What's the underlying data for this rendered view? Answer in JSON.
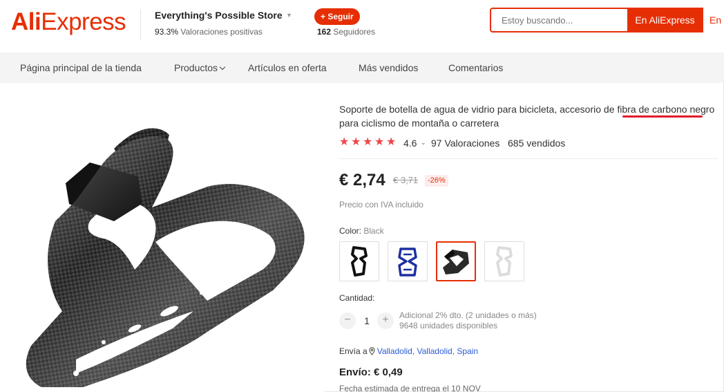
{
  "header": {
    "logo_text_part1": "Ali",
    "logo_text_part2": "Express",
    "store_name": "Everything's Possible Store",
    "rating_percent": "93.3%",
    "rating_label": "Valoraciones positivas",
    "follow_label": "+ Seguir",
    "followers_count": "162",
    "followers_label": "Seguidores",
    "search_placeholder": "Estoy buscando...",
    "search_ali_button": "En AliExpress",
    "search_store_button": "En e"
  },
  "nav": {
    "items": [
      {
        "label": "Página principal de la tienda"
      },
      {
        "label": "Productos"
      },
      {
        "label": "Artículos en oferta"
      },
      {
        "label": "Más vendidos"
      },
      {
        "label": "Comentarios"
      }
    ]
  },
  "product": {
    "title": "Soporte de botella de agua de vidrio para bicicleta, accesorio de fibra de carbono negro para ciclismo de montaña o carretera",
    "rating": "4.6",
    "reviews": "97 Valoraciones",
    "sold": "685 vendidos",
    "price": "€ 2,74",
    "old_price": "€ 3,71",
    "discount": "-26%",
    "vat_note": "Precio con IVA incluido",
    "color_label": "Color:",
    "color_value": "Black",
    "swatches": [
      {
        "name": "black"
      },
      {
        "name": "blue"
      },
      {
        "name": "carbon"
      },
      {
        "name": "white"
      }
    ],
    "quantity_label": "Cantidad:",
    "quantity": "1",
    "quantity_discount": "Adicional 2% dto. (2 unidades o más)",
    "stock": "9648 unidades disponibles",
    "ship_to_label": "Envía a",
    "ship_to_location": "Valladolid, Valladolid, Spain",
    "shipping": "Envío: € 0,49",
    "delivery": "Fecha estimada de entrega el 10 NOV"
  },
  "colors": {
    "brand": "#e62e04",
    "star": "#f0454a",
    "link": "#2a5ad4",
    "annotation": "#e01b2b"
  }
}
